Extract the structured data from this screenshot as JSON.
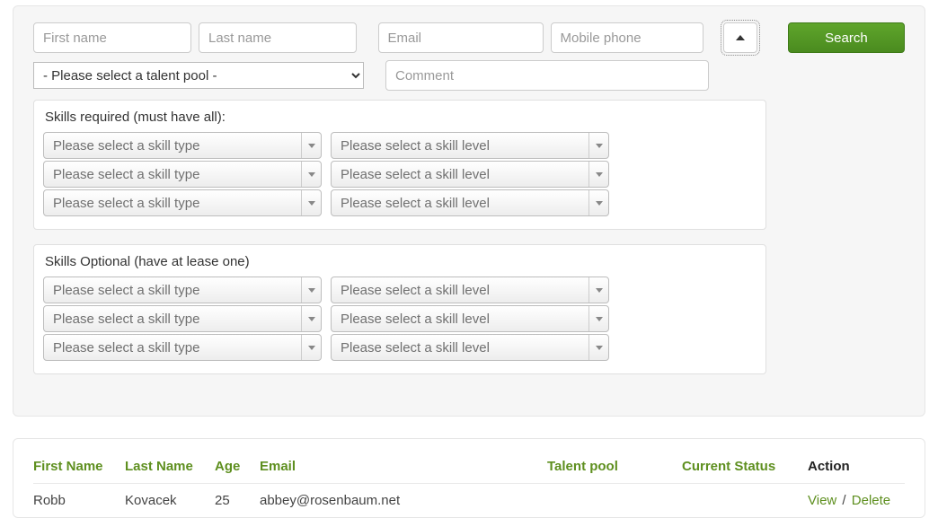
{
  "search_form": {
    "first_name_placeholder": "First name",
    "last_name_placeholder": "Last name",
    "email_placeholder": "Email",
    "mobile_placeholder": "Mobile phone",
    "search_label": "Search",
    "talent_pool_placeholder": "- Please select a talent pool -",
    "comment_placeholder": "Comment"
  },
  "skills_required": {
    "title": "Skills required (must have all):",
    "rows": [
      {
        "type_placeholder": "Please select a skill type",
        "level_placeholder": "Please select a skill level"
      },
      {
        "type_placeholder": "Please select a skill type",
        "level_placeholder": "Please select a skill level"
      },
      {
        "type_placeholder": "Please select a skill type",
        "level_placeholder": "Please select a skill level"
      }
    ]
  },
  "skills_optional": {
    "title": "Skills Optional (have at lease one)",
    "rows": [
      {
        "type_placeholder": "Please select a skill type",
        "level_placeholder": "Please select a skill level"
      },
      {
        "type_placeholder": "Please select a skill type",
        "level_placeholder": "Please select a skill level"
      },
      {
        "type_placeholder": "Please select a skill type",
        "level_placeholder": "Please select a skill level"
      }
    ]
  },
  "results": {
    "headers": {
      "first_name": "First Name",
      "last_name": "Last Name",
      "age": "Age",
      "email": "Email",
      "talent_pool": "Talent pool",
      "current_status": "Current Status",
      "action": "Action"
    },
    "rows": [
      {
        "first_name": "Robb",
        "last_name": "Kovacek",
        "age": "25",
        "email": "abbey@rosenbaum.net",
        "talent_pool": "",
        "current_status": "",
        "view_label": "View",
        "delete_label": "Delete",
        "separator": " / "
      }
    ]
  }
}
